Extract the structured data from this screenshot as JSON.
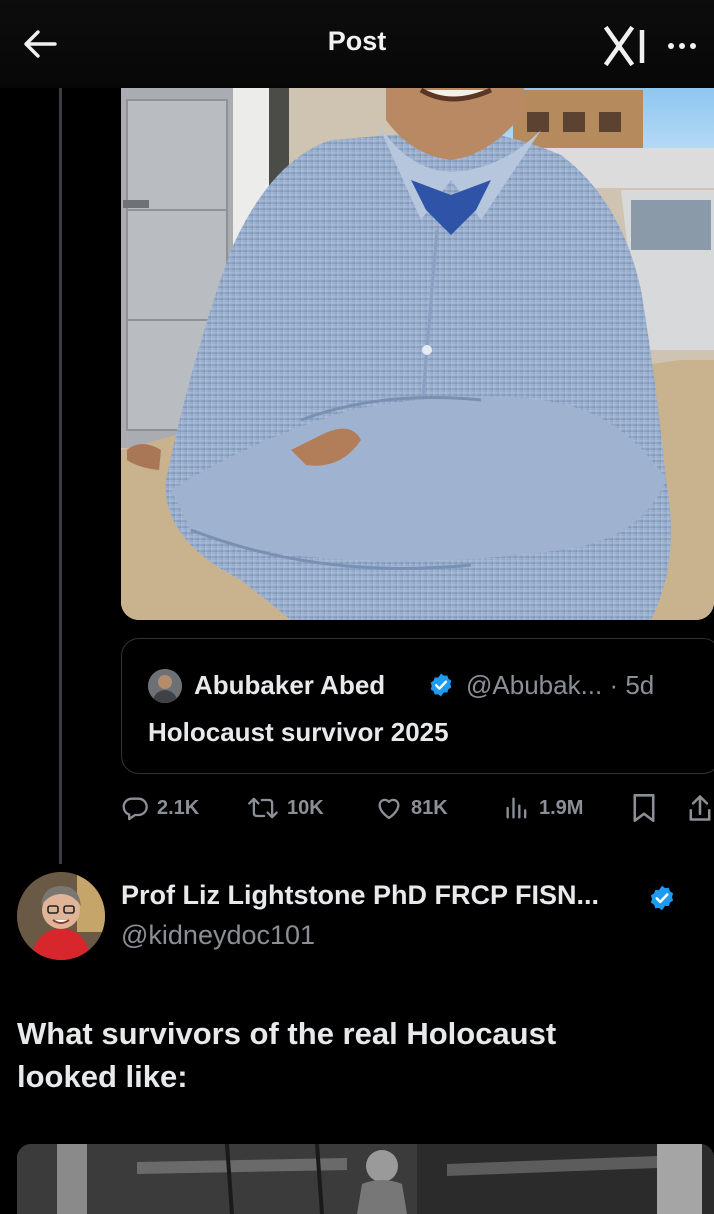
{
  "header": {
    "title": "Post",
    "back_icon": "arrow-left-icon",
    "logo_icon": "x-grok-logo-icon",
    "more_icon": "more-dots-icon"
  },
  "quoted_post": {
    "author_name": "Abubaker Abed",
    "handle_time": "@Abubak... · 5d",
    "text": "Holocaust survivor 2025",
    "verified": true
  },
  "actions": {
    "replies": "2.1K",
    "reposts": "10K",
    "likes": "81K",
    "views": "1.9M"
  },
  "reply_post": {
    "author_name": "Prof Liz Lightstone PhD FRCP FISN...",
    "handle": "@kidneydoc101",
    "text": "What survivors of the real Holocaust looked like:",
    "verified": true
  },
  "colors": {
    "background": "#000000",
    "text": "#e7e9ea",
    "muted": "#8b9096",
    "verified": "#1d9bf0",
    "border": "#2f3336"
  }
}
